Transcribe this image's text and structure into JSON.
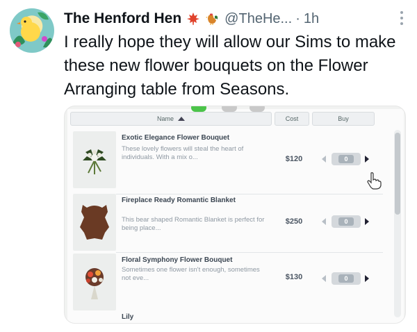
{
  "author": {
    "display_name": "The Henford Hen",
    "handle": "@TheHe...",
    "separator": "·",
    "time": "1h",
    "emoji_1": "maple-leaf-icon",
    "emoji_2": "rooster-icon"
  },
  "tweet": {
    "text": "I really hope they will allow our Sims to make these new flower bouquets on the Flower Arranging table from Seasons."
  },
  "shop": {
    "columns": {
      "name": "Name",
      "cost": "Cost",
      "buy": "Buy"
    },
    "items": [
      {
        "title": "Exotic Elegance Flower Bouquet",
        "description": "These lovely flowers will steal the heart of individuals. With a mix o...",
        "price": "$120",
        "quantity": "0"
      },
      {
        "title": "Fireplace Ready Romantic Blanket",
        "description": "This bear shaped Romantic Blanket is perfect for being place...",
        "price": "$250",
        "quantity": "0"
      },
      {
        "title": "Floral Symphony Flower Bouquet",
        "description": "Sometimes one flower isn't enough, sometimes not eve...",
        "price": "$130",
        "quantity": "0"
      },
      {
        "title": "Lily"
      }
    ]
  },
  "colors": {
    "accent_green": "#4cc44a",
    "text_primary": "#0f1419",
    "text_secondary": "#536471"
  }
}
